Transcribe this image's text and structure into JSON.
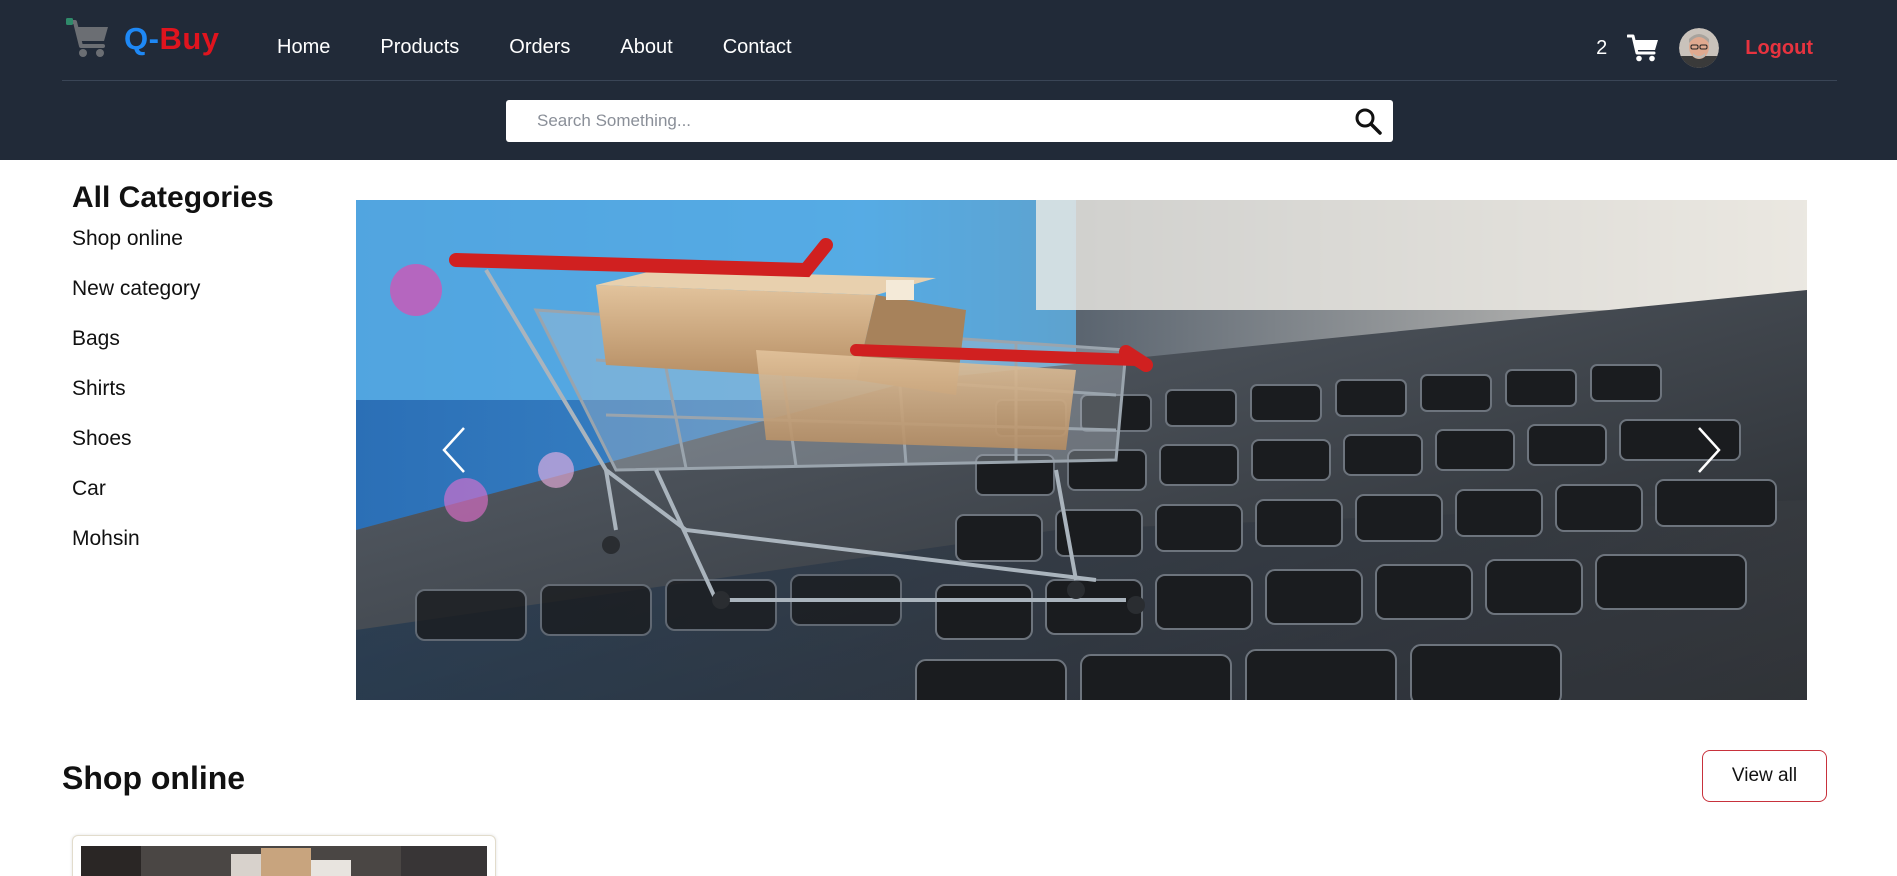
{
  "brand": {
    "name_prefix": "Q-",
    "name_suffix": "Buy",
    "prefix_color": "#1e88f5",
    "suffix_color": "#e0141e",
    "icon": "shopping-cart-icon"
  },
  "nav": {
    "items": [
      {
        "label": "Home"
      },
      {
        "label": "Products"
      },
      {
        "label": "Orders"
      },
      {
        "label": "About"
      },
      {
        "label": "Contact"
      }
    ]
  },
  "user": {
    "cart_count": "2",
    "cart_icon": "cart-icon",
    "avatar": "user-avatar",
    "logout_label": "Logout",
    "logout_color": "#e8333f"
  },
  "search": {
    "placeholder": "Search Something...",
    "value": "",
    "icon": "search-icon"
  },
  "sidebar": {
    "title": "All Categories",
    "categories": [
      {
        "label": "Shop online"
      },
      {
        "label": "New category"
      },
      {
        "label": "Bags"
      },
      {
        "label": "Shirts"
      },
      {
        "label": "Shoes"
      },
      {
        "label": "Car"
      },
      {
        "label": "Mohsin"
      }
    ]
  },
  "carousel": {
    "image": "shopping-cart-on-laptop-keyboard",
    "prev_icon": "chevron-left-icon",
    "next_icon": "chevron-right-icon"
  },
  "section": {
    "title": "Shop online",
    "view_all_label": "View all",
    "view_all_border_color": "#c8323c"
  },
  "colors": {
    "header_bg": "#212a38",
    "page_bg": "#ffffff"
  }
}
